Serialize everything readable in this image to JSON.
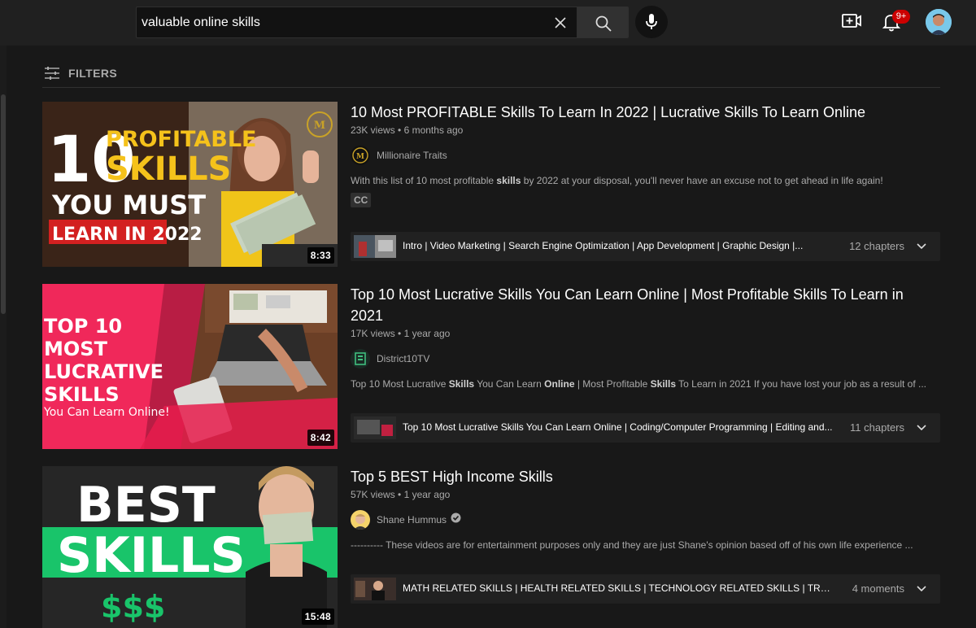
{
  "search": {
    "query": "valuable online skills"
  },
  "header": {
    "notification_count": "9+"
  },
  "filters": {
    "label": "FILTERS"
  },
  "results": [
    {
      "title": "10 Most PROFITABLE Skills To Learn In 2022 | Lucrative Skills To Learn Online",
      "views": "23K views",
      "age": "6 months ago",
      "channel": "Millionaire Traits",
      "verified": false,
      "description_parts": [
        {
          "t": "With this list of 10 most profitable ",
          "b": false
        },
        {
          "t": "skills",
          "b": true
        },
        {
          "t": " by 2022 at your disposal, you'll never have an excuse not to get ahead in life again!",
          "b": false
        }
      ],
      "badge": "CC",
      "duration": "8:33",
      "thumbnail_text": {
        "num": "10",
        "line1": "PROFITABLE",
        "line2": "SKILLS",
        "line3": "YOU MUST",
        "line4": "LEARN IN 2022"
      },
      "chapters_text": "Intro | Video Marketing | Search Engine Optimization | App Development | Graphic Design |...",
      "chapters_count": "12 chapters"
    },
    {
      "title": "Top 10 Most Lucrative Skills You Can Learn Online | Most Profitable Skills To Learn in 2021",
      "views": "17K views",
      "age": "1 year ago",
      "channel": "District10TV",
      "verified": false,
      "description_parts": [
        {
          "t": "Top 10 Most Lucrative ",
          "b": false
        },
        {
          "t": "Skills",
          "b": true
        },
        {
          "t": " You Can Learn ",
          "b": false
        },
        {
          "t": "Online",
          "b": true
        },
        {
          "t": " | Most Profitable ",
          "b": false
        },
        {
          "t": "Skills",
          "b": true
        },
        {
          "t": " To Learn in 2021 If you have lost your job as a result of ...",
          "b": false
        }
      ],
      "badge": "",
      "duration": "8:42",
      "thumbnail_text": {
        "line1": "TOP 10",
        "line2": "MOST",
        "line3": "LUCRATIVE",
        "line4": "SKILLS",
        "line5": "You Can Learn Online!"
      },
      "chapters_text": "Top 10 Most Lucrative Skills You Can Learn Online | Coding/Computer Programming | Editing and...",
      "chapters_count": "11 chapters"
    },
    {
      "title": "Top 5 BEST High Income Skills",
      "views": "57K views",
      "age": "1 year ago",
      "channel": "Shane Hummus",
      "verified": true,
      "description_parts": [
        {
          "t": "---------- These videos are for entertainment purposes only and they are just Shane's opinion based off of his own life experience ...",
          "b": false
        }
      ],
      "badge": "",
      "duration": "15:48",
      "thumbnail_text": {
        "line1": "BEST",
        "line2": "SKILLS",
        "line3": "$$$"
      },
      "chapters_text": "MATH RELATED SKILLS | HEALTH RELATED SKILLS | TECHNOLOGY RELATED SKILLS | TRUCKING",
      "chapters_count": "4 moments"
    }
  ]
}
